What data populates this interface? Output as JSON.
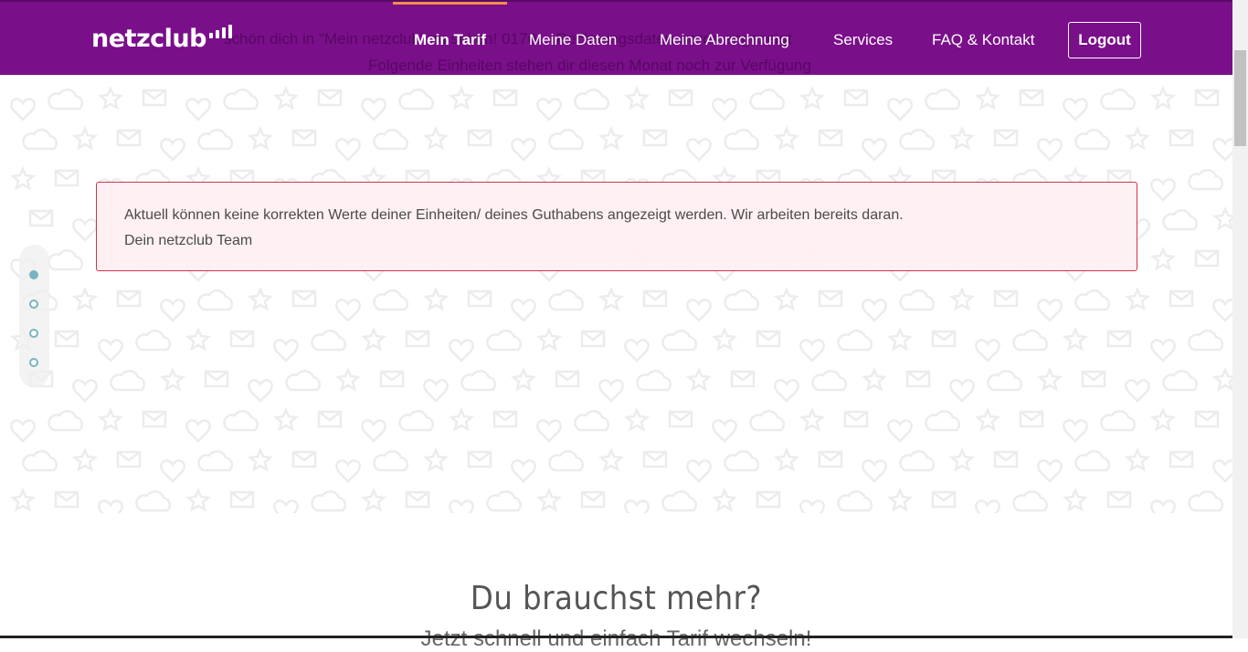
{
  "header": {
    "logo_text": "netzclub",
    "ghost_text_1": "schön dich in \"Mein netzclub\" zu sehen! 0170… Rechnungsdaten werde angezeigt",
    "ghost_text_2": "Folgende Einheiten stehen dir diesen Monat noch zur Verfügung",
    "nav": [
      {
        "label": "Mein Tarif",
        "active": true
      },
      {
        "label": "Meine Daten",
        "active": false
      },
      {
        "label": "Meine Abrechnung",
        "active": false
      },
      {
        "label": "Services",
        "active": false
      },
      {
        "label": "FAQ & Kontakt",
        "active": false
      }
    ],
    "logout_label": "Logout"
  },
  "alert": {
    "line1": "Aktuell können keine korrekten Werte deiner Einheiten/ deines Guthabens angezeigt werden. Wir arbeiten bereits daran.",
    "line2": "Dein netzclub Team"
  },
  "side_nav": {
    "dots": 4,
    "active_index": 0
  },
  "section": {
    "headline": "Du brauchst mehr?",
    "subline": "Jetzt schnell und einfach Tarif wechseln!"
  },
  "colors": {
    "brand_purple": "#7a0f8a",
    "accent_orange": "#f28c4b",
    "alert_border": "#d4314a",
    "dot_color": "#7ab4c2"
  }
}
